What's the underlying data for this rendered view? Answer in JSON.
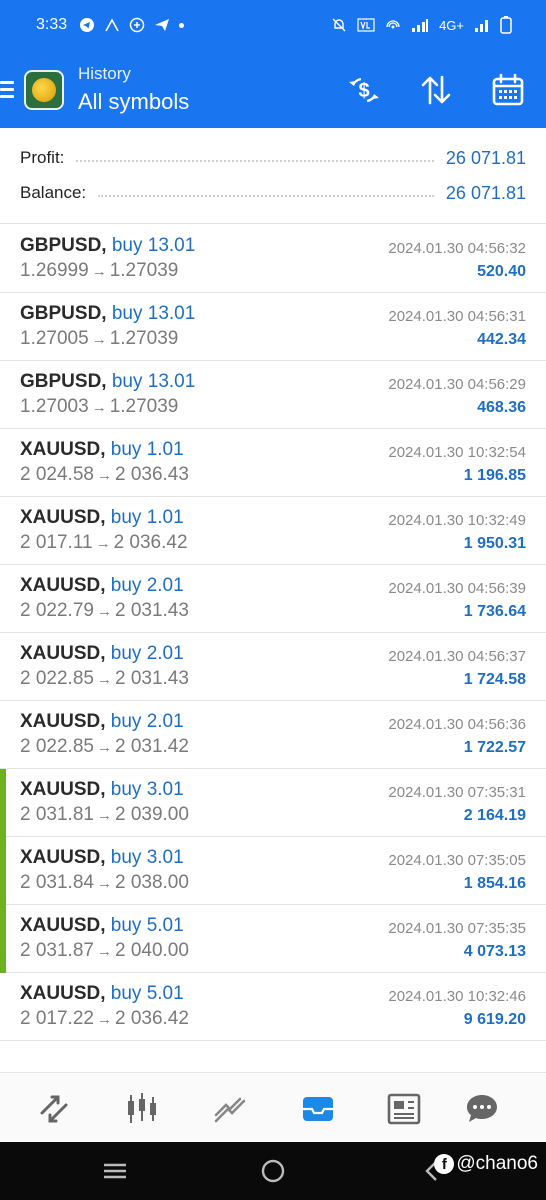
{
  "status_bar": {
    "time": "3:33",
    "network": "4G+"
  },
  "header": {
    "subtitle": "History",
    "title": "All symbols"
  },
  "summary": {
    "profit_label": "Profit:",
    "profit_value": "26 071.81",
    "balance_label": "Balance:",
    "balance_value": "26 071.81"
  },
  "trades": [
    {
      "symbol": "GBPUSD,",
      "side": "buy 13.01",
      "open": "1.26999",
      "close": "1.27039",
      "datetime": "2024.01.30 04:56:32",
      "profit": "520.40",
      "marked": false
    },
    {
      "symbol": "GBPUSD,",
      "side": "buy 13.01",
      "open": "1.27005",
      "close": "1.27039",
      "datetime": "2024.01.30 04:56:31",
      "profit": "442.34",
      "marked": false
    },
    {
      "symbol": "GBPUSD,",
      "side": "buy 13.01",
      "open": "1.27003",
      "close": "1.27039",
      "datetime": "2024.01.30 04:56:29",
      "profit": "468.36",
      "marked": false
    },
    {
      "symbol": "XAUUSD,",
      "side": "buy 1.01",
      "open": "2 024.58",
      "close": "2 036.43",
      "datetime": "2024.01.30 10:32:54",
      "profit": "1 196.85",
      "marked": false
    },
    {
      "symbol": "XAUUSD,",
      "side": "buy 1.01",
      "open": "2 017.11",
      "close": "2 036.42",
      "datetime": "2024.01.30 10:32:49",
      "profit": "1 950.31",
      "marked": false
    },
    {
      "symbol": "XAUUSD,",
      "side": "buy 2.01",
      "open": "2 022.79",
      "close": "2 031.43",
      "datetime": "2024.01.30 04:56:39",
      "profit": "1 736.64",
      "marked": false
    },
    {
      "symbol": "XAUUSD,",
      "side": "buy 2.01",
      "open": "2 022.85",
      "close": "2 031.43",
      "datetime": "2024.01.30 04:56:37",
      "profit": "1 724.58",
      "marked": false
    },
    {
      "symbol": "XAUUSD,",
      "side": "buy 2.01",
      "open": "2 022.85",
      "close": "2 031.42",
      "datetime": "2024.01.30 04:56:36",
      "profit": "1 722.57",
      "marked": false
    },
    {
      "symbol": "XAUUSD,",
      "side": "buy 3.01",
      "open": "2 031.81",
      "close": "2 039.00",
      "datetime": "2024.01.30 07:35:31",
      "profit": "2 164.19",
      "marked": true
    },
    {
      "symbol": "XAUUSD,",
      "side": "buy 3.01",
      "open": "2 031.84",
      "close": "2 038.00",
      "datetime": "2024.01.30 07:35:05",
      "profit": "1 854.16",
      "marked": true
    },
    {
      "symbol": "XAUUSD,",
      "side": "buy 5.01",
      "open": "2 031.87",
      "close": "2 040.00",
      "datetime": "2024.01.30 07:35:35",
      "profit": "4 073.13",
      "marked": true
    },
    {
      "symbol": "XAUUSD,",
      "side": "buy 5.01",
      "open": "2 017.22",
      "close": "2 036.42",
      "datetime": "2024.01.30 10:32:46",
      "profit": "9 619.20",
      "marked": false
    }
  ],
  "arrow_glyph": "→",
  "bottom_nav": [
    "quotes-icon",
    "chart-icon",
    "trade-icon",
    "history-icon",
    "news-icon",
    "chat-icon"
  ],
  "watermark": "@chano6",
  "colors": {
    "header_bg": "#1976f0",
    "accent_blue": "#1e6fc4",
    "marker_green": "#6cb11f",
    "active_nav": "#1e88e5"
  }
}
